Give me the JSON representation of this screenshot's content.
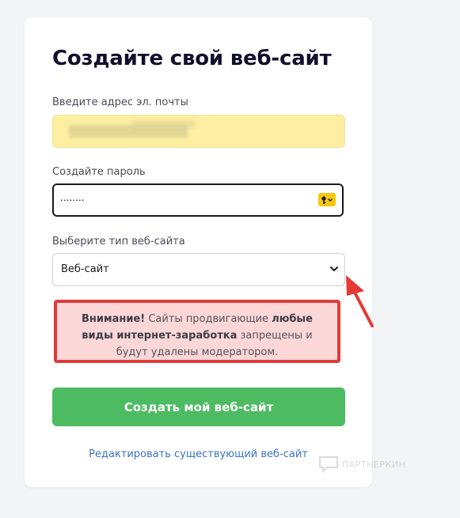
{
  "form": {
    "title": "Создайте свой веб-сайт",
    "email_label": "Введите адрес эл. почты",
    "password_label": "Создайте пароль",
    "password_value": "........",
    "site_type_label": "Выберите тип веб-сайта",
    "site_type_value": "Веб-сайт",
    "warning": {
      "part1": "Внимание!",
      "part2": " Сайты продвигающие ",
      "part3": "любые виды интернет-заработка",
      "part4": " запрещены и будут удалены модератором."
    },
    "submit_label": "Создать мой веб-сайт",
    "edit_link": "Редактировать существующий веб-сайт"
  },
  "watermark": "ПАРТНЕРКИН",
  "colors": {
    "primary_button": "#4dbb62",
    "warning_border": "#df3b3b",
    "warning_bg": "#fbd7d7",
    "link": "#3b73c4",
    "autofill": "#fcefa1",
    "annotation_arrow": "#e53935"
  }
}
